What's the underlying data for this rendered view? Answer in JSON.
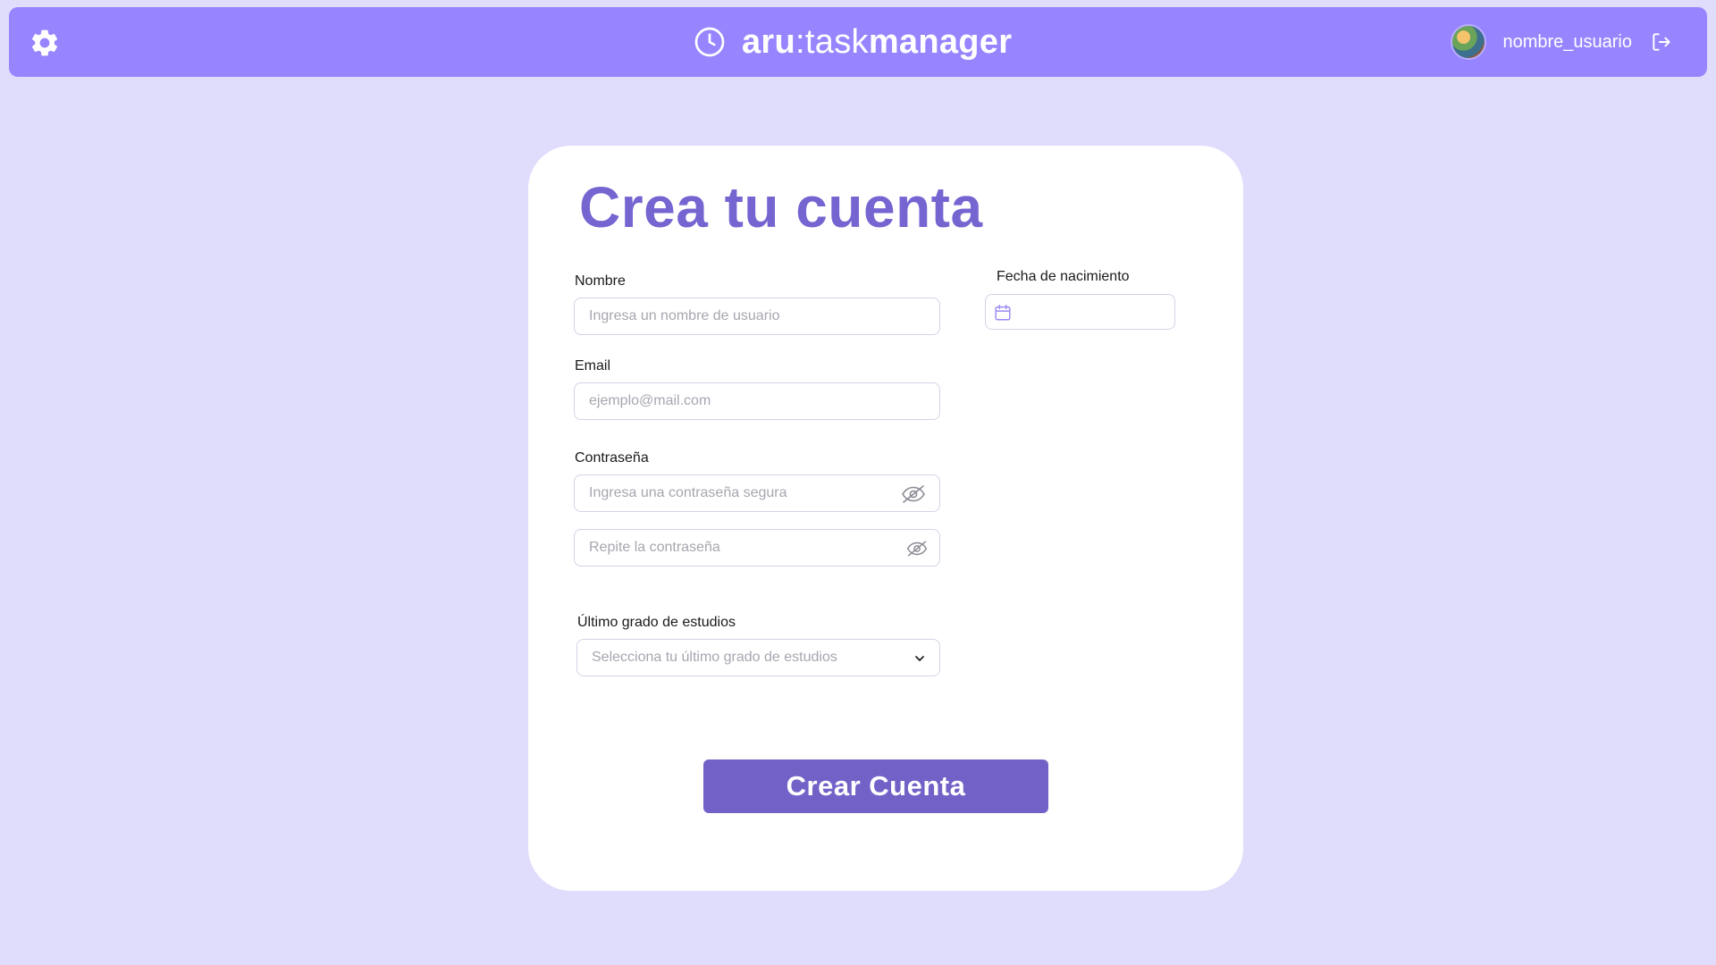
{
  "header": {
    "settings_icon": "gear-icon",
    "brand_icon": "clock-icon",
    "brand": {
      "part1": "aru",
      "separator": ":",
      "part2": "task",
      "part3": "manager"
    },
    "username": "nombre_usuario",
    "logout_icon": "logout-icon"
  },
  "form": {
    "title": "Crea tu cuenta",
    "name": {
      "label": "Nombre",
      "placeholder": "Ingresa un nombre de usuario",
      "value": ""
    },
    "email": {
      "label": "Email",
      "placeholder": "ejemplo@mail.com",
      "value": ""
    },
    "password": {
      "label": "Contraseña",
      "placeholder": "Ingresa una contraseña segura",
      "confirm_placeholder": "Repite la contraseña"
    },
    "education": {
      "label": "Último grado de estudios",
      "placeholder": "Selecciona tu último grado de estudios"
    },
    "birthdate": {
      "label": "Fecha de nacimiento",
      "value": ""
    },
    "submit_label": "Crear Cuenta"
  },
  "colors": {
    "background": "#e0dcfc",
    "header": "#9685ff",
    "accent": "#7262c7",
    "title": "#7565d1"
  }
}
